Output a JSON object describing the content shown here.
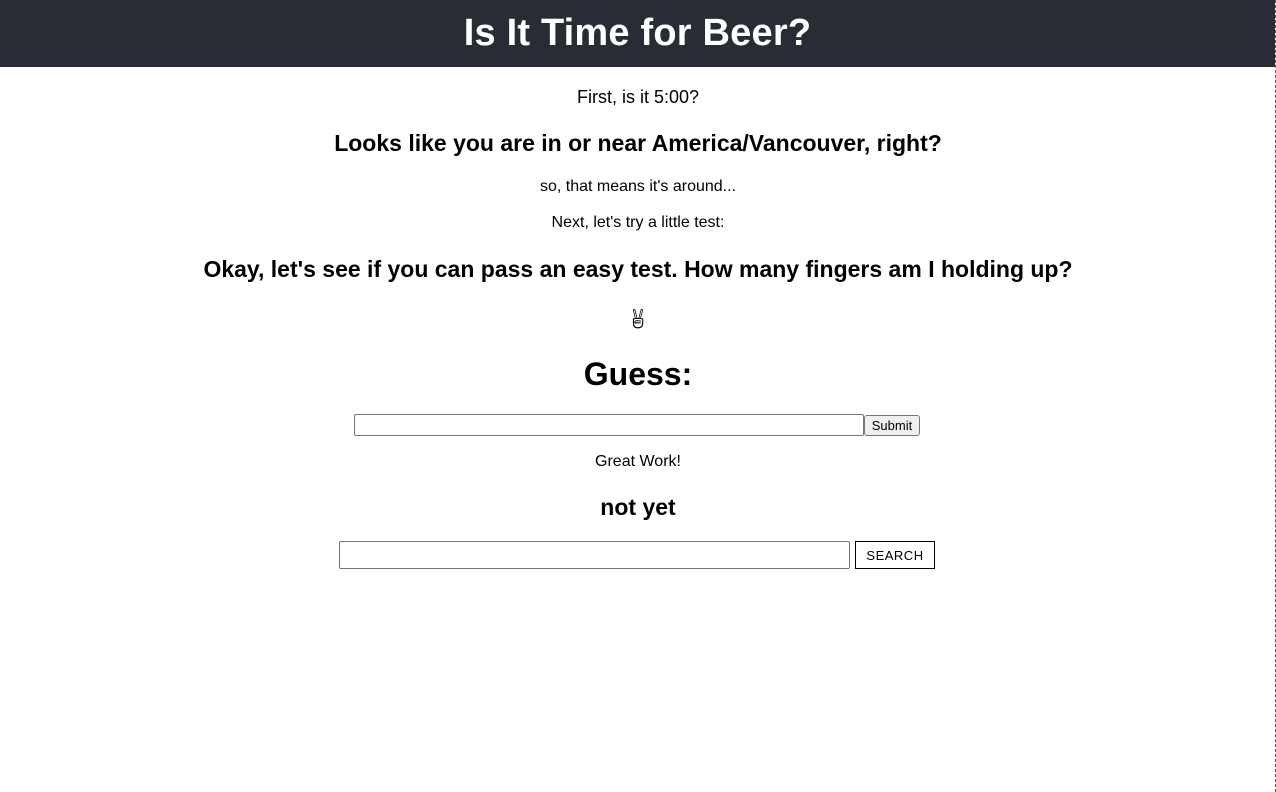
{
  "header": {
    "title": "Is It Time for Beer?"
  },
  "main": {
    "intro": "First, is it 5:00?",
    "location_heading": "Looks like you are in or near America/Vancouver, right?",
    "time_text": "so, that means it's around...",
    "next_text": "Next, let's try a little test:",
    "test_heading": "Okay, let's see if you can pass an easy test. How many fingers am I holding up?",
    "hand_icon": "victory-hand-icon",
    "guess_heading": "Guess:",
    "guess_form": {
      "input_value": "",
      "submit_label": "Submit"
    },
    "feedback": "Great Work!",
    "result": "not yet",
    "search_form": {
      "input_value": "",
      "search_label": "SEARCH"
    }
  },
  "colors": {
    "header_bg": "#282c34",
    "header_text": "#ffffff"
  }
}
